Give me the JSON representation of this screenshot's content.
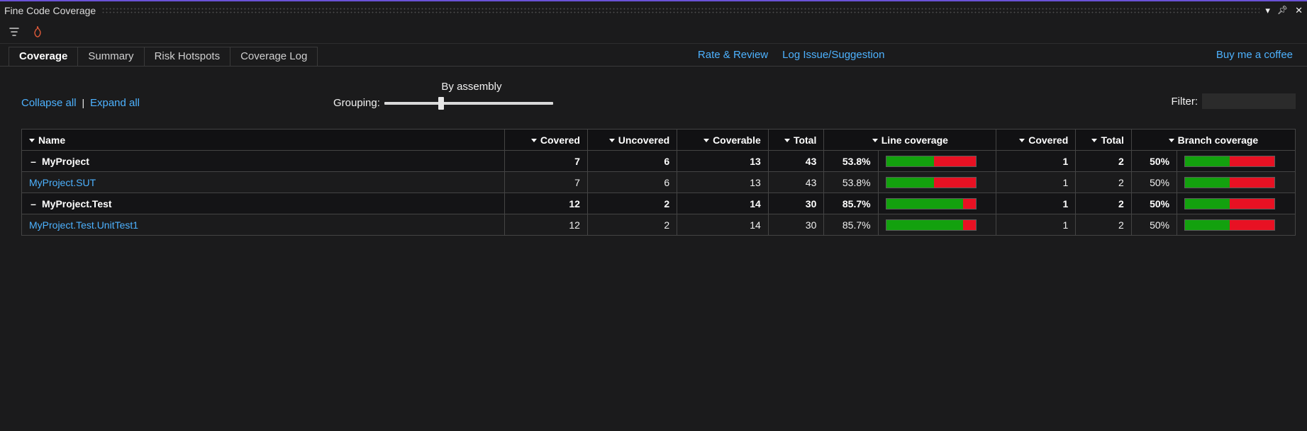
{
  "window": {
    "title": "Fine Code Coverage"
  },
  "tabs": {
    "items": [
      {
        "label": "Coverage",
        "active": true
      },
      {
        "label": "Summary",
        "active": false
      },
      {
        "label": "Risk Hotspots",
        "active": false
      },
      {
        "label": "Coverage Log",
        "active": false
      }
    ],
    "center_links": {
      "rate": "Rate & Review",
      "issue": "Log Issue/Suggestion"
    },
    "right_link": "Buy me a coffee"
  },
  "controls": {
    "collapse": "Collapse all",
    "expand": "Expand all",
    "grouping_label": "Grouping:",
    "grouping_mode": "By assembly",
    "filter_label": "Filter:",
    "filter_value": ""
  },
  "table": {
    "headers": {
      "name": "Name",
      "covered": "Covered",
      "uncovered": "Uncovered",
      "coverable": "Coverable",
      "total": "Total",
      "line_coverage": "Line coverage",
      "b_covered": "Covered",
      "b_total": "Total",
      "branch_coverage": "Branch coverage"
    },
    "rows": [
      {
        "type": "group",
        "name": "MyProject",
        "covered": "7",
        "uncovered": "6",
        "coverable": "13",
        "total": "43",
        "line_pct": "53.8%",
        "line_val": 53.8,
        "b_covered": "1",
        "b_total": "2",
        "b_pct": "50%",
        "b_val": 50
      },
      {
        "type": "child",
        "name": "MyProject.SUT",
        "covered": "7",
        "uncovered": "6",
        "coverable": "13",
        "total": "43",
        "line_pct": "53.8%",
        "line_val": 53.8,
        "b_covered": "1",
        "b_total": "2",
        "b_pct": "50%",
        "b_val": 50
      },
      {
        "type": "group",
        "name": "MyProject.Test",
        "covered": "12",
        "uncovered": "2",
        "coverable": "14",
        "total": "30",
        "line_pct": "85.7%",
        "line_val": 85.7,
        "b_covered": "1",
        "b_total": "2",
        "b_pct": "50%",
        "b_val": 50
      },
      {
        "type": "child",
        "name": "MyProject.Test.UnitTest1",
        "covered": "12",
        "uncovered": "2",
        "coverable": "14",
        "total": "30",
        "line_pct": "85.7%",
        "line_val": 85.7,
        "b_covered": "1",
        "b_total": "2",
        "b_pct": "50%",
        "b_val": 50
      }
    ]
  }
}
